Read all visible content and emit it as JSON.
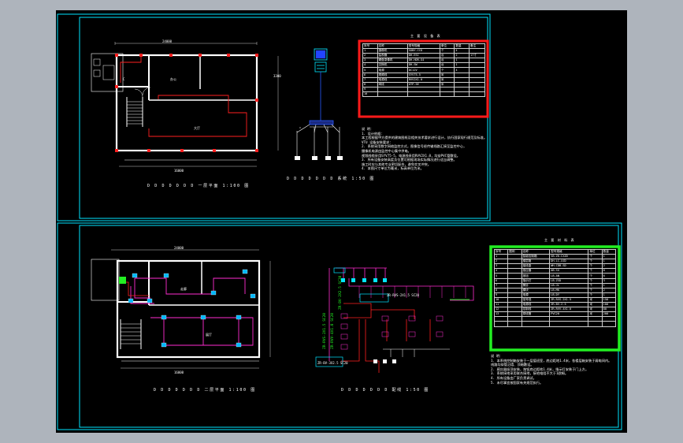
{
  "colors": {
    "background": "#000000",
    "frame": "#00e5ff",
    "walls": "#ffffff",
    "red_table_border": "#ff1a1a",
    "green_table_border": "#22ee22",
    "magenta_wiring": "#ff2cd0",
    "red_wiring": "#ff2020"
  },
  "plan_upper": {
    "caption": "D D D D D D D 一层平面 1:100 图",
    "dims": {
      "top": "24000",
      "bottom": "16000",
      "right": "3300"
    },
    "rooms": {
      "center": "办公",
      "small": "C",
      "lower": "大厅"
    }
  },
  "plan_lower": {
    "caption": "D D D D D D D 二层平面 1:100 图",
    "dims": {
      "top": "24000",
      "bottom": "16000"
    },
    "rooms": {
      "center": "走廊",
      "lower": "展厅"
    }
  },
  "system_upper": {
    "caption": "D D D D D D D 系统 1:50 图",
    "icons": [
      "computer-icon",
      "switch-icon",
      "camera-icon"
    ]
  },
  "system_lower": {
    "caption": "D D D D D D D 配线 1:50 图"
  },
  "table_red": {
    "title": "主 要 设 备 表",
    "rows": [
      [
        "序号",
        "名称",
        "型号规格",
        "单位",
        "数量",
        "备注"
      ],
      [
        "1",
        "摄像机",
        "SONY-CCD",
        "个",
        "4",
        ""
      ],
      [
        "2",
        "监视器",
        "DH-ESC",
        "台",
        "2",
        "17寸"
      ],
      [
        "3",
        "硬盘录像机",
        "DH-HDR-G4",
        "台",
        "1",
        ""
      ],
      [
        "4",
        "交换机",
        "DH-SW",
        "台",
        "1",
        ""
      ],
      [
        "5",
        "电源",
        "DC12V",
        "个",
        "4",
        ""
      ],
      [
        "6",
        "视频线",
        "SYV75-5",
        "米",
        "",
        ""
      ],
      [
        "7",
        "电源线",
        "RVV2X1.0",
        "米",
        "",
        ""
      ],
      [
        "8",
        "网线",
        "UTP-5E",
        "米",
        "",
        ""
      ],
      [
        "9",
        "",
        "",
        "",
        "",
        ""
      ],
      [
        "10",
        "",
        "",
        "",
        "",
        ""
      ]
    ]
  },
  "table_green": {
    "title": "主 要 材 料 表",
    "rows": [
      [
        "序号",
        "图例",
        "名称",
        "型号规格",
        "单位",
        "数量"
      ],
      [
        "1",
        "",
        "智能控制箱",
        "SB-ZK-CXZD",
        "个",
        "1"
      ],
      [
        "2",
        "",
        "楼层箱",
        "DH-LC-XZD",
        "个",
        "1"
      ],
      [
        "3",
        "",
        "接线盒",
        "WH-CDB-SD",
        "个",
        "2"
      ],
      [
        "4",
        "",
        "感应器",
        "AB-SG",
        "个",
        "8"
      ],
      [
        "5",
        "",
        "按钮",
        "LB-AN",
        "个",
        "6"
      ],
      [
        "6",
        "",
        "指示灯",
        "LB-ZSD",
        "个",
        "3"
      ],
      [
        "7",
        "",
        "警铃",
        "LB-JL",
        "个",
        "1"
      ],
      [
        "8",
        "",
        "模块",
        "LB-MK",
        "个",
        "2"
      ],
      [
        "9",
        "",
        "电源",
        "LB-DY",
        "个",
        "1"
      ],
      [
        "10",
        "",
        "信号线",
        "ZR-RVS-2X1.5",
        "米",
        "150"
      ],
      [
        "11",
        "",
        "电源线",
        "ZR-BV-2.5",
        "米",
        "100"
      ],
      [
        "12",
        "",
        "控制线",
        "ZR-RVV-4X1.0",
        "米",
        "80"
      ],
      [
        "13",
        "",
        "穿线管",
        "PVC20",
        "米",
        "200"
      ],
      [
        "",
        "",
        "",
        "",
        "",
        ""
      ],
      [
        "",
        "",
        "",
        "",
        "",
        ""
      ]
    ]
  },
  "notes_upper": [
    "说 明：",
    "1. 设计依据：",
    "   本工程根据甲方提供的建筑图纸及相关技术要求进行设计，执行国家现行规范及标准。",
    "VTU 设备安装要求：",
    "2. 系统采用数字网络监控方式，图像信号经传输线路汇接至监控中心，",
    "   摄像机电源由监控中心集中供电。",
    "   视频线缆采用SYV75-5，电源线采用RVV2X1.0，均穿PVC管敷设。",
    "3. 所有设备安装高度及位置可根据现场实际情况进行适当调整。",
    "   施工时应与其他专业密切配合，避免交叉冲突。",
    "4. 本图尺寸单位为毫米，标高单位为米。"
  ],
  "notes_lower": [
    "说 明：",
    "1. 本系统控制箱安装于一层值班室，底边距地1.4米，各楼层箱安装于弱电间内。",
    "   线路均穿管沿墙、顶暗敷设。",
    "2. 感应器吸顶安装，按钮底边距地1.4米，指示灯安装于门上方。",
    "3. 系统接地采用联合接地，接地电阻不大于1欧姆。",
    "4. 所有设备由厂家负责调试。",
    "5. 未尽事宜按国家有关规范执行。"
  ],
  "riser_labels": [
    "ZR-RVS-2X1.5 SC20",
    "ZR-RVV-4X1.0 SC20",
    "ZR-BV-2X2.5 SC20",
    "ZR-RVS-2X1.5 SC20",
    "ZR-BV-3X2.5 SC20"
  ]
}
